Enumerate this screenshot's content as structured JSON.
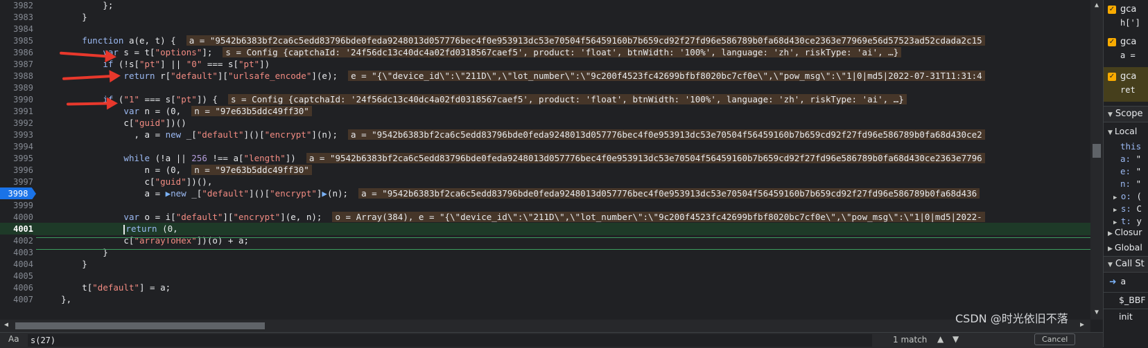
{
  "editor": {
    "lines": [
      {
        "n": "3982",
        "code": [
          {
            "t": "            };"
          }
        ]
      },
      {
        "n": "3983",
        "code": [
          {
            "t": "        }"
          }
        ]
      },
      {
        "n": "3984",
        "code": [
          {
            "t": ""
          }
        ]
      },
      {
        "n": "3985",
        "code": [
          {
            "t": "        "
          },
          {
            "t": "function",
            "c": "kw"
          },
          {
            "t": " a(e, t) {  "
          },
          {
            "t": "a = \"9542b6383bf2ca6c5edd83796bde0feda9248013d057776bec4f0e953913dc53e70504f56459160b7b659cd92f27fd96e586789b0fa68d430ce2363e77969e56d57523ad52cdada2c15",
            "c": "val"
          }
        ]
      },
      {
        "n": "3986",
        "code": [
          {
            "t": "            "
          },
          {
            "t": "var",
            "c": "kw"
          },
          {
            "t": " s = t["
          },
          {
            "t": "\"options\"",
            "c": "str"
          },
          {
            "t": "];  "
          },
          {
            "t": "s = Config {captchaId: '24f56dc13c40dc4a02fd0318567caef5', product: 'float', btnWidth: '100%', language: 'zh', riskType: 'ai', …}",
            "c": "val"
          }
        ]
      },
      {
        "n": "3987",
        "code": [
          {
            "t": "            "
          },
          {
            "t": "if",
            "c": "kw"
          },
          {
            "t": " (!s["
          },
          {
            "t": "\"pt\"",
            "c": "str"
          },
          {
            "t": "] || "
          },
          {
            "t": "\"0\"",
            "c": "str"
          },
          {
            "t": " === s["
          },
          {
            "t": "\"pt\"",
            "c": "str"
          },
          {
            "t": "])"
          }
        ]
      },
      {
        "n": "3988",
        "code": [
          {
            "t": "                "
          },
          {
            "t": "return",
            "c": "kw"
          },
          {
            "t": " r["
          },
          {
            "t": "\"default\"",
            "c": "str"
          },
          {
            "t": "]["
          },
          {
            "t": "\"urlsafe_encode\"",
            "c": "str"
          },
          {
            "t": "](e);  "
          },
          {
            "t": "e = \"{\\\"device_id\\\":\\\"211D\\\",\\\"lot_number\\\":\\\"9c200f4523fc42699bfbf8020bc7cf0e\\\",\\\"pow_msg\\\":\\\"1|0|md5|2022-07-31T11:31:4",
            "c": "val"
          }
        ]
      },
      {
        "n": "3989",
        "code": [
          {
            "t": ""
          }
        ]
      },
      {
        "n": "3990",
        "code": [
          {
            "t": "            "
          },
          {
            "t": "if",
            "c": "kw"
          },
          {
            "t": " ("
          },
          {
            "t": "\"1\"",
            "c": "str"
          },
          {
            "t": " === s["
          },
          {
            "t": "\"pt\"",
            "c": "str"
          },
          {
            "t": "]) {  "
          },
          {
            "t": "s = Config {captchaId: '24f56dc13c40dc4a02fd0318567caef5', product: 'float', btnWidth: '100%', language: 'zh', riskType: 'ai', …}",
            "c": "val"
          }
        ]
      },
      {
        "n": "3991",
        "code": [
          {
            "t": "                "
          },
          {
            "t": "var",
            "c": "kw"
          },
          {
            "t": " n = (0,  "
          },
          {
            "t": "n = \"97e63b5ddc49ff30\"",
            "c": "val"
          }
        ]
      },
      {
        "n": "3992",
        "code": [
          {
            "t": "                c["
          },
          {
            "t": "\"guid\"",
            "c": "str"
          },
          {
            "t": "])()"
          }
        ]
      },
      {
        "n": "3993",
        "code": [
          {
            "t": "                  , a = "
          },
          {
            "t": "new",
            "c": "kw"
          },
          {
            "t": " _["
          },
          {
            "t": "\"default\"",
            "c": "str"
          },
          {
            "t": "]()["
          },
          {
            "t": "\"encrypt\"",
            "c": "str"
          },
          {
            "t": "](n);  "
          },
          {
            "t": "a = \"9542b6383bf2ca6c5edd83796bde0feda9248013d057776bec4f0e953913dc53e70504f56459160b7b659cd92f27fd96e586789b0fa68d430ce2",
            "c": "val"
          }
        ]
      },
      {
        "n": "3994",
        "code": [
          {
            "t": ""
          }
        ]
      },
      {
        "n": "3995",
        "code": [
          {
            "t": "                "
          },
          {
            "t": "while",
            "c": "kw"
          },
          {
            "t": " (!a || "
          },
          {
            "t": "256",
            "c": "num"
          },
          {
            "t": " !== a["
          },
          {
            "t": "\"length\"",
            "c": "str"
          },
          {
            "t": "])  "
          },
          {
            "t": "a = \"9542b6383bf2ca6c5edd83796bde0feda9248013d057776bec4f0e953913dc53e70504f56459160b7b659cd92f27fd96e586789b0fa68d430ce2363e7796",
            "c": "val"
          }
        ]
      },
      {
        "n": "3996",
        "code": [
          {
            "t": "                    n = (0,  "
          },
          {
            "t": "n = \"97e63b5ddc49ff30\"",
            "c": "val"
          }
        ]
      },
      {
        "n": "3997",
        "code": [
          {
            "t": "                    c["
          },
          {
            "t": "\"guid\"",
            "c": "str"
          },
          {
            "t": "])(),"
          }
        ]
      },
      {
        "n": "3998",
        "bp": true,
        "code": [
          {
            "t": "                    a = "
          },
          {
            "t": "▶",
            "c": "marker"
          },
          {
            "t": "new",
            "c": "kw"
          },
          {
            "t": " _["
          },
          {
            "t": "\"default\"",
            "c": "str"
          },
          {
            "t": "]()["
          },
          {
            "t": "\"encrypt\"",
            "c": "str"
          },
          {
            "t": "]"
          },
          {
            "t": "▶",
            "c": "marker"
          },
          {
            "t": "(n);  "
          },
          {
            "t": "a = \"9542b6383bf2ca6c5edd83796bde0feda9248013d057776bec4f0e953913dc53e70504f56459160b7b659cd92f27fd96e586789b0fa68d436",
            "c": "val"
          }
        ]
      },
      {
        "n": "3999",
        "code": [
          {
            "t": ""
          }
        ]
      },
      {
        "n": "4000",
        "code": [
          {
            "t": "                "
          },
          {
            "t": "var",
            "c": "kw"
          },
          {
            "t": " o = i["
          },
          {
            "t": "\"default\"",
            "c": "str"
          },
          {
            "t": "]["
          },
          {
            "t": "\"encrypt\"",
            "c": "str"
          },
          {
            "t": "](e, n);  "
          },
          {
            "t": "o = Array(384), e = \"{\\\"device_id\\\":\\\"211D\\\",\\\"lot_number\\\":\\\"9c200f4523fc42699bfbf8020bc7cf0e\\\",\\\"pow_msg\\\":\\\"1|0|md5|2022-",
            "c": "val"
          }
        ]
      },
      {
        "n": "4001",
        "cur": true,
        "code": [
          {
            "t": "                "
          },
          {
            "t": "|",
            "c": "cursorc"
          },
          {
            "t": "return",
            "c": "kw"
          },
          {
            "t": " (0,"
          }
        ]
      },
      {
        "n": "4002",
        "code": [
          {
            "t": "                c["
          },
          {
            "t": "\"arrayToHex\"",
            "c": "str"
          },
          {
            "t": "])(o) + a;"
          }
        ]
      },
      {
        "n": "4003",
        "code": [
          {
            "t": "            }"
          }
        ]
      },
      {
        "n": "4004",
        "code": [
          {
            "t": "        }"
          }
        ]
      },
      {
        "n": "4005",
        "code": [
          {
            "t": ""
          }
        ]
      },
      {
        "n": "4006",
        "code": [
          {
            "t": "        t["
          },
          {
            "t": "\"default\"",
            "c": "str"
          },
          {
            "t": "] = a;"
          }
        ]
      },
      {
        "n": "4007",
        "code": [
          {
            "t": "    },"
          }
        ]
      }
    ]
  },
  "search": {
    "case_label": "Aa",
    "query": "s(27)",
    "match_text": "1 match",
    "cancel_label": "Cancel"
  },
  "panel": {
    "breakpoints": [
      {
        "file": "gca",
        "code": "h[']"
      },
      {
        "file": "gca",
        "code": "a ="
      },
      {
        "file": "gca",
        "code": "ret"
      }
    ],
    "scope_title": "Scope",
    "local_title": "Local",
    "scope_rows": [
      {
        "k": "this",
        "v": ""
      },
      {
        "k": "a:",
        "v": " \""
      },
      {
        "k": "e:",
        "v": " \""
      },
      {
        "k": "n:",
        "v": " \""
      },
      {
        "k": "o:",
        "v": " ("
      },
      {
        "k": "s:",
        "v": " C"
      },
      {
        "k": "t:",
        "v": " y"
      }
    ],
    "closure_title": "Closur",
    "global_title": "Global",
    "callstack_title": "Call St",
    "frames": [
      "a",
      "$_BBF",
      "init"
    ]
  },
  "watermark": "CSDN @时光依旧不落"
}
